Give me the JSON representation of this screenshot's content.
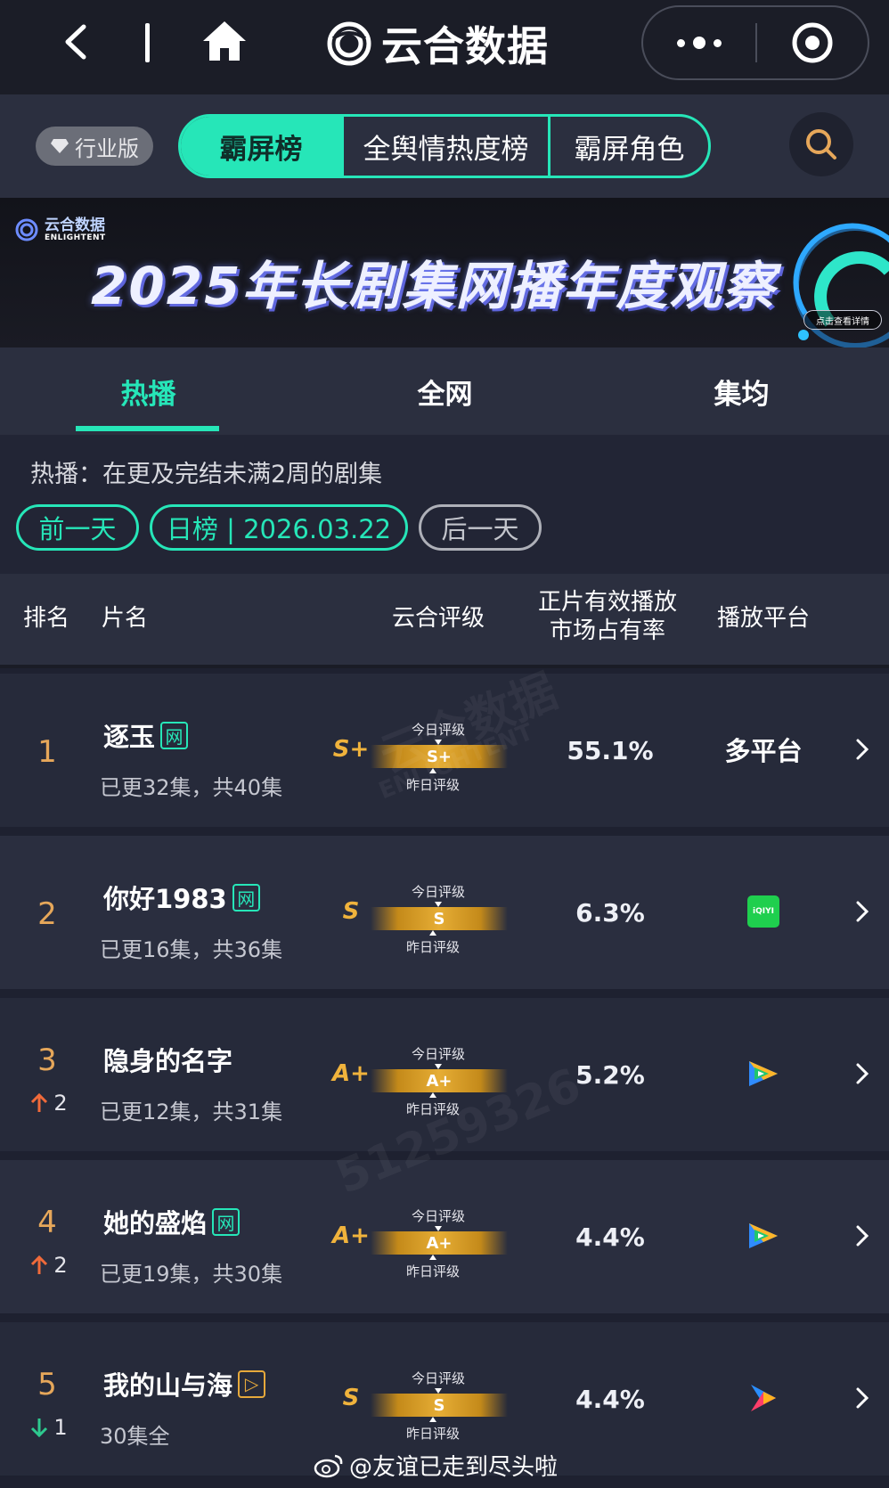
{
  "app": {
    "title": "云合数据"
  },
  "tabs": {
    "industry_badge": "行业版",
    "segments": [
      "霸屏榜",
      "全舆情热度榜",
      "霸屏角色"
    ]
  },
  "banner": {
    "brand_cn": "云合数据",
    "brand_en": "ENLIGHTENT",
    "title": "2025年长剧集网播年度观察",
    "detail_button": "点击查看详情"
  },
  "subtabs": [
    "热播",
    "全网",
    "集均"
  ],
  "filter": {
    "note": "热播：在更及完结未满2周的剧集",
    "prev": "前一天",
    "current": "日榜 | 2026.03.22",
    "next": "后一天"
  },
  "table": {
    "headers": {
      "rank": "排名",
      "name": "片名",
      "grade": "云合评级",
      "share_line1": "正片有效播放",
      "share_line2": "市场占有率",
      "platform": "播放平台"
    },
    "gauge_today": "今日评级",
    "gauge_yesterday": "昨日评级",
    "rows": [
      {
        "rank": "1",
        "change": "",
        "name": "逐玉",
        "tag": "网",
        "episodes": "已更32集，共40集",
        "grade": "S+",
        "bar": "S+",
        "share": "55.1%",
        "platform": "多平台",
        "platform_icon": "multi-platform"
      },
      {
        "rank": "2",
        "change": "",
        "name": "你好1983",
        "tag": "网",
        "episodes": "已更16集，共36集",
        "grade": "S",
        "bar": "S",
        "share": "6.3%",
        "platform": "",
        "platform_icon": "iqiyi-icon"
      },
      {
        "rank": "3",
        "change": "2",
        "change_dir": "up",
        "name": "隐身的名字",
        "tag": "",
        "episodes": "已更12集，共31集",
        "grade": "A+",
        "bar": "A+",
        "share": "5.2%",
        "platform": "",
        "platform_icon": "tencent-video-icon"
      },
      {
        "rank": "4",
        "change": "2",
        "change_dir": "up",
        "name": "她的盛焰",
        "tag": "网",
        "episodes": "已更19集，共30集",
        "grade": "A+",
        "bar": "A+",
        "share": "4.4%",
        "platform": "",
        "platform_icon": "tencent-video-icon"
      },
      {
        "rank": "5",
        "change": "1",
        "change_dir": "down",
        "name": "我的山与海",
        "tag": "▷",
        "episodes": "30集全",
        "grade": "S",
        "bar": "S",
        "share": "4.4%",
        "platform": "",
        "platform_icon": "youku-icon"
      }
    ]
  },
  "watermark": {
    "handle": "@友谊已走到尽头啦",
    "bg_text": "云合数据",
    "bg_en": "ENLIGHTENT",
    "bg_number": "51259326"
  },
  "iqiyi_label": "iQIYI",
  "colors": {
    "accent": "#26e6b8",
    "rank": "#e6a75a",
    "grade": "#f0b33c",
    "up": "#f06a3a",
    "down": "#2ec98f"
  }
}
